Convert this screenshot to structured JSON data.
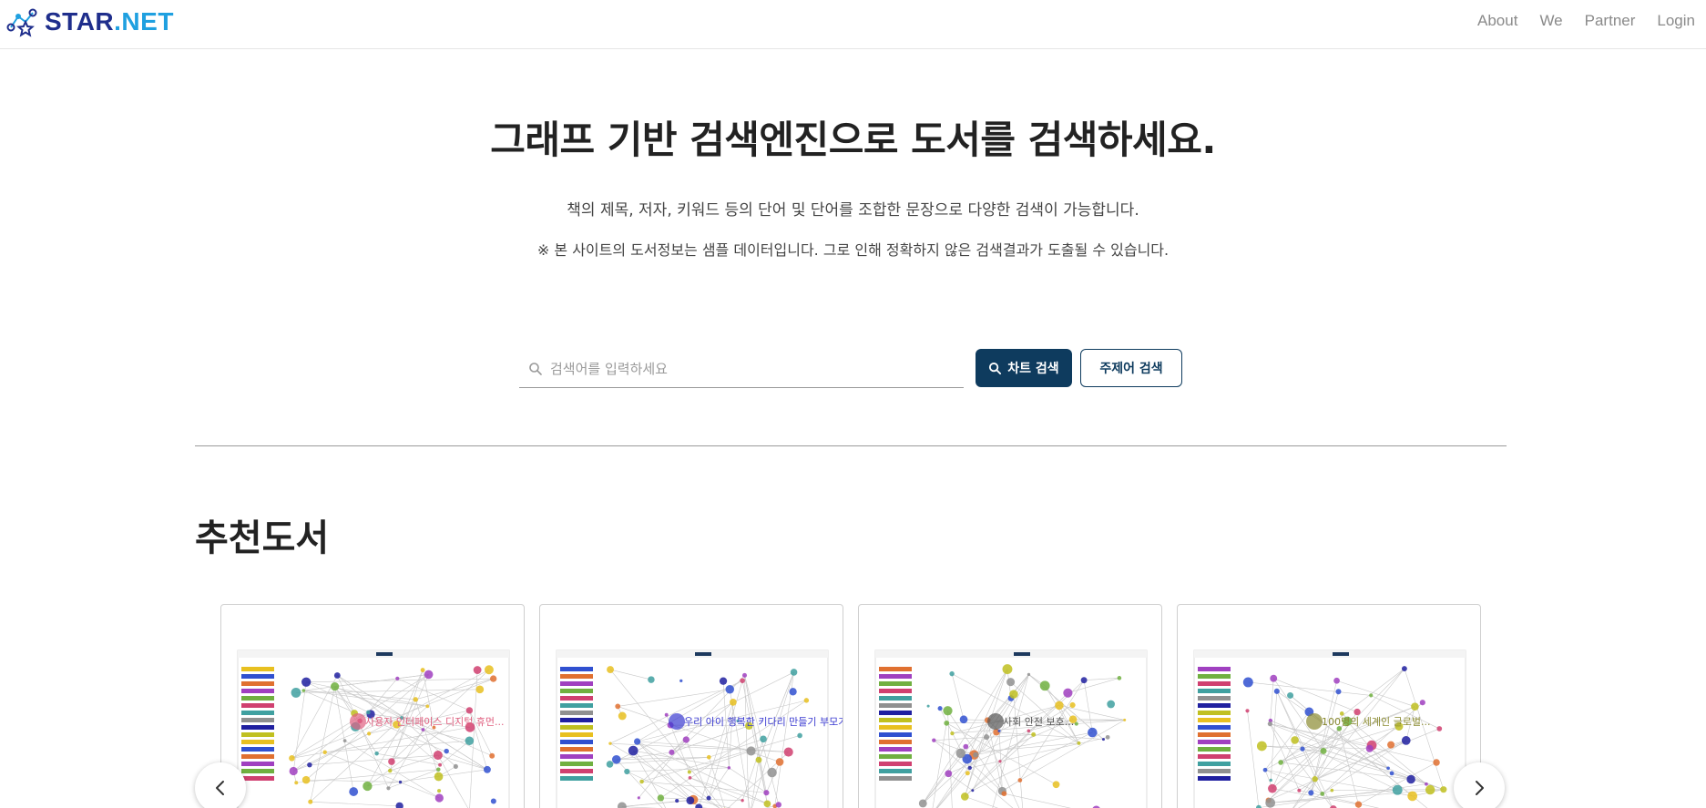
{
  "header": {
    "logo_star": "STAR",
    "logo_net": ".NET",
    "nav": [
      "About",
      "We",
      "Partner",
      "Login"
    ]
  },
  "hero": {
    "title": "그래프 기반 검색엔진으로 도서를 검색하세요.",
    "subtitle": "책의 제목, 저자, 키워드 등의 단어 및 단어를 조합한 문장으로 다양한 검색이 가능합니다.",
    "note": "※ 본 사이트의 도서정보는 샘플 데이터입니다. 그로 인해 정확하지 않은 검색결과가 도출될 수 있습니다."
  },
  "search": {
    "placeholder": "검색어를 입력하세요",
    "value": "",
    "chart_button": "차트 검색",
    "topic_button": "주제어 검색"
  },
  "recommended": {
    "title": "추천도서",
    "cards": [
      {
        "label": "사용자 인터페이스 디지털 휴먼...",
        "accent": "#e06080"
      },
      {
        "label": "우리 아이 행복한 키다리 만들기 부모가...",
        "accent": "#3a3ad0"
      },
      {
        "label": "사회 안전 보호...",
        "accent": "#555555"
      },
      {
        "label": "100명의 세계인 글로벌...",
        "accent": "#8a8a30"
      }
    ]
  },
  "colors": {
    "primary": "#0e3b5e",
    "logo_star": "#1f2e8c",
    "logo_net": "#1fa0e0",
    "nav_text": "#8a8a8a"
  }
}
